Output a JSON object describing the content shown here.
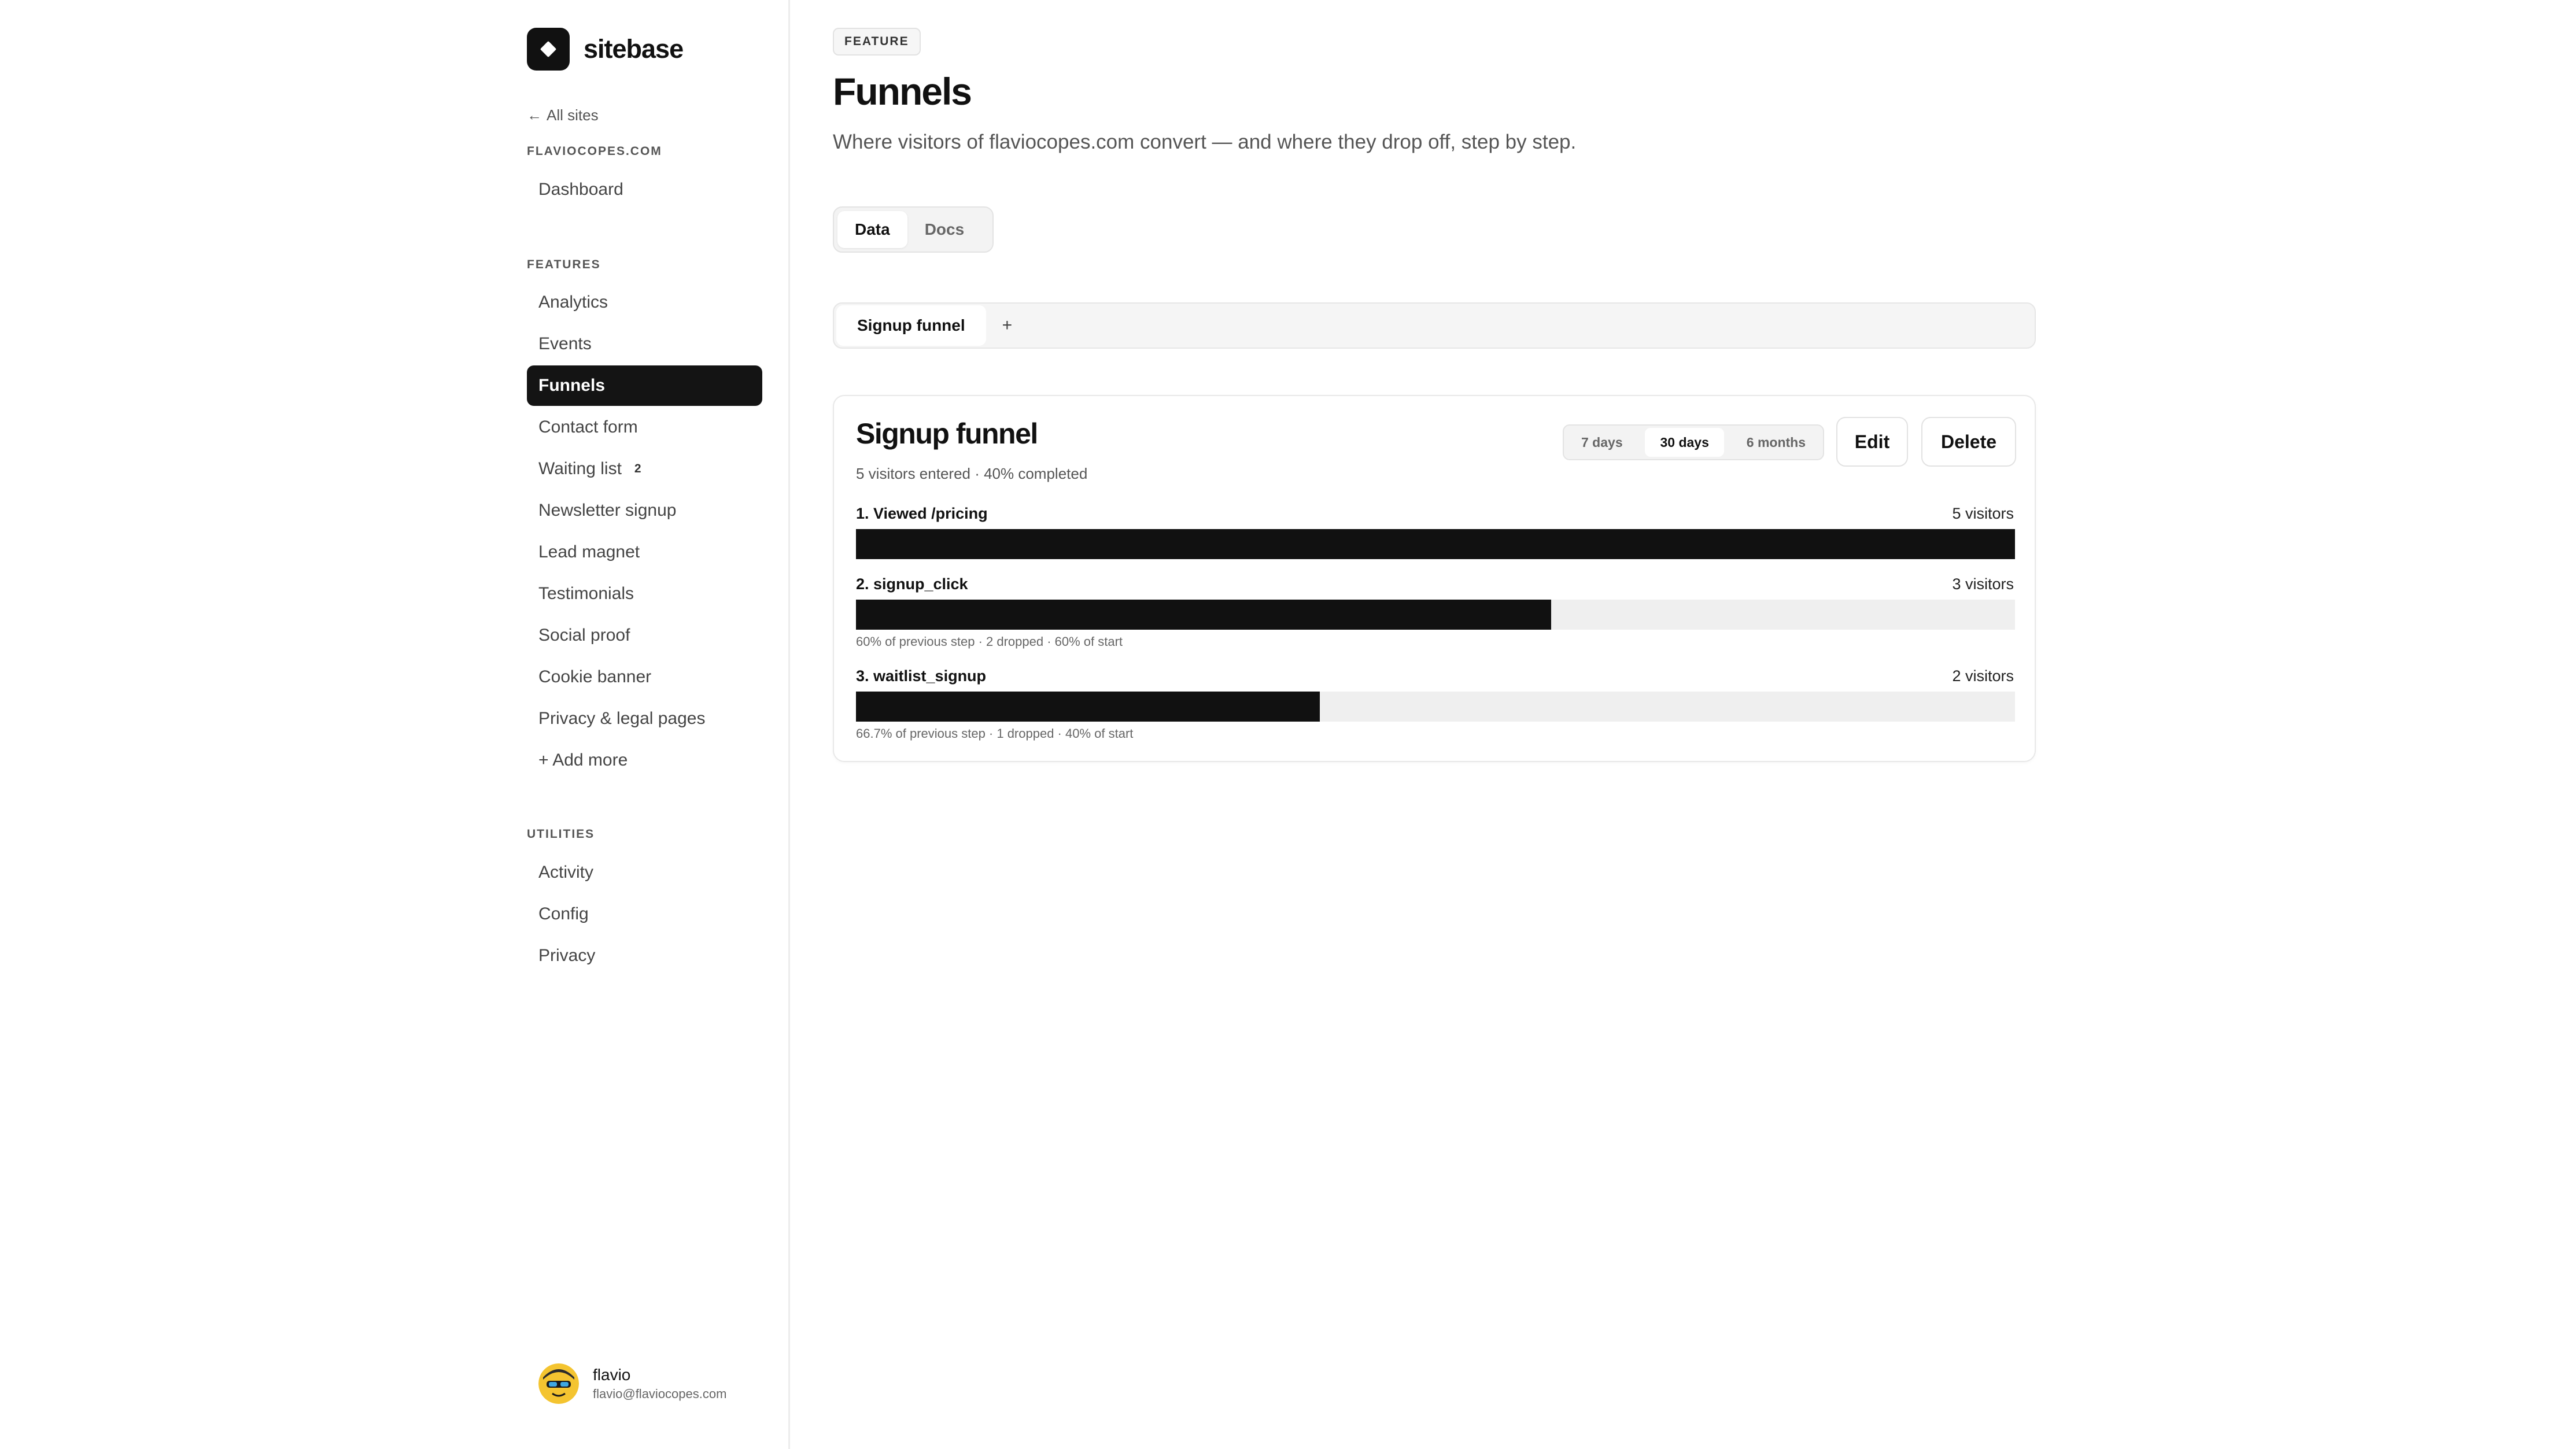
{
  "brand": {
    "name": "sitebase",
    "icon": "diamond-logo-icon"
  },
  "sidebar": {
    "back_label": "All sites",
    "site_label": "FLAVIOCOPES.COM",
    "dashboard": "Dashboard",
    "features_label": "FEATURES",
    "features": [
      {
        "label": "Analytics"
      },
      {
        "label": "Events"
      },
      {
        "label": "Funnels",
        "active": true
      },
      {
        "label": "Contact form"
      },
      {
        "label": "Waiting list",
        "badge": "2"
      },
      {
        "label": "Newsletter signup"
      },
      {
        "label": "Lead magnet"
      },
      {
        "label": "Testimonials"
      },
      {
        "label": "Social proof"
      },
      {
        "label": "Cookie banner"
      },
      {
        "label": "Privacy & legal pages"
      },
      {
        "label": "+ Add more"
      }
    ],
    "utilities_label": "UTILITIES",
    "utilities": [
      {
        "label": "Activity"
      },
      {
        "label": "Config"
      },
      {
        "label": "Privacy"
      }
    ],
    "user": {
      "name": "flavio",
      "email": "flavio@flaviocopes.com"
    }
  },
  "main": {
    "badge": "FEATURE",
    "title": "Funnels",
    "subtitle": "Where visitors of flaviocopes.com convert — and where they drop off, step by step.",
    "view_toggle": {
      "data": "Data",
      "docs": "Docs",
      "active": "Data"
    },
    "funnel_tabs": [
      {
        "label": "Signup funnel",
        "active": true
      }
    ],
    "add_tab": "+"
  },
  "funnel": {
    "title": "Signup funnel",
    "summary": "5 visitors entered · 40% completed",
    "ranges": {
      "r7": "7 days",
      "r30": "30 days",
      "r6m": "6 months",
      "active": "30 days"
    },
    "edit_label": "Edit",
    "delete_label": "Delete",
    "steps": [
      {
        "label": "1. Viewed /pricing",
        "count": "5 visitors",
        "fraction": 1.0,
        "note": ""
      },
      {
        "label": "2. signup_click",
        "count": "3 visitors",
        "fraction": 0.6,
        "note": "60% of previous step · 2 dropped · 60% of start"
      },
      {
        "label": "3. waitlist_signup",
        "count": "2 visitors",
        "fraction": 0.4,
        "note": "66.7% of previous step · 1 dropped · 40% of start"
      }
    ]
  },
  "colors": {
    "accent": "#111111",
    "track": "#efefef",
    "border": "#e6e6e6"
  }
}
